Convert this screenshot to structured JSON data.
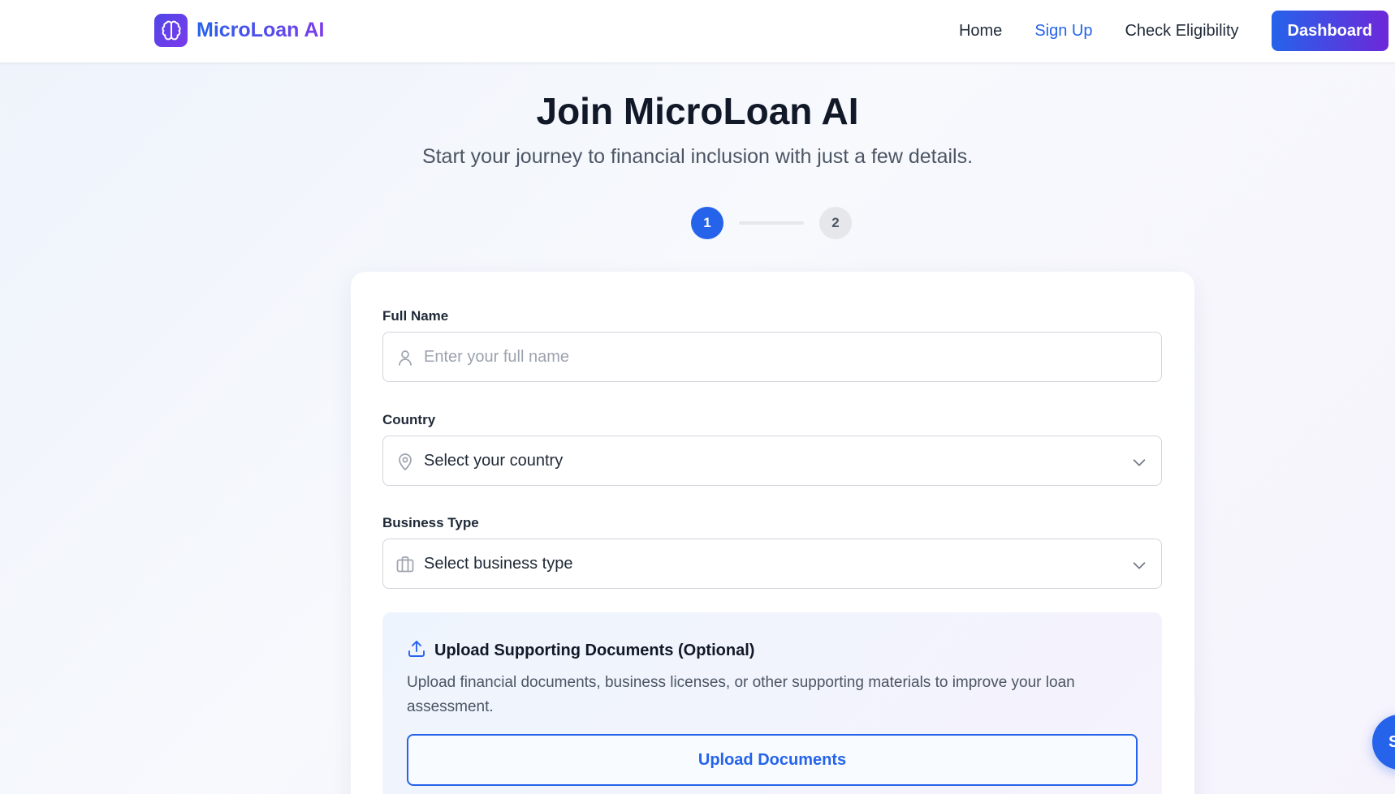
{
  "nav": {
    "brand": "MicroLoan AI",
    "links": [
      "Home",
      "Sign Up",
      "Check Eligibility"
    ],
    "active_link": "Sign Up",
    "dashboard_label": "Dashboard"
  },
  "hero": {
    "title": "Join MicroLoan AI",
    "subtitle": "Start your journey to financial inclusion with just a few details."
  },
  "stepper": {
    "steps": [
      "1",
      "2"
    ],
    "current": 1
  },
  "form": {
    "full_name": {
      "label": "Full Name",
      "placeholder": "Enter your full name",
      "value": "",
      "icon": "user-icon"
    },
    "country": {
      "label": "Country",
      "selected": "Select your country",
      "icon": "map-pin-icon"
    },
    "business_type": {
      "label": "Business Type",
      "selected": "Select business type",
      "icon": "briefcase-icon"
    },
    "upload": {
      "title": "Upload Supporting Documents (Optional)",
      "description": "Upload financial documents, business licenses, or other supporting materials to improve your loan assessment.",
      "button_label": "Upload Documents",
      "icon": "upload-icon"
    }
  },
  "fab": {
    "label": "S"
  },
  "colors": {
    "primary": "#2563eb",
    "accent": "#7c3aed",
    "text": "#111827",
    "muted": "#4b5563"
  }
}
